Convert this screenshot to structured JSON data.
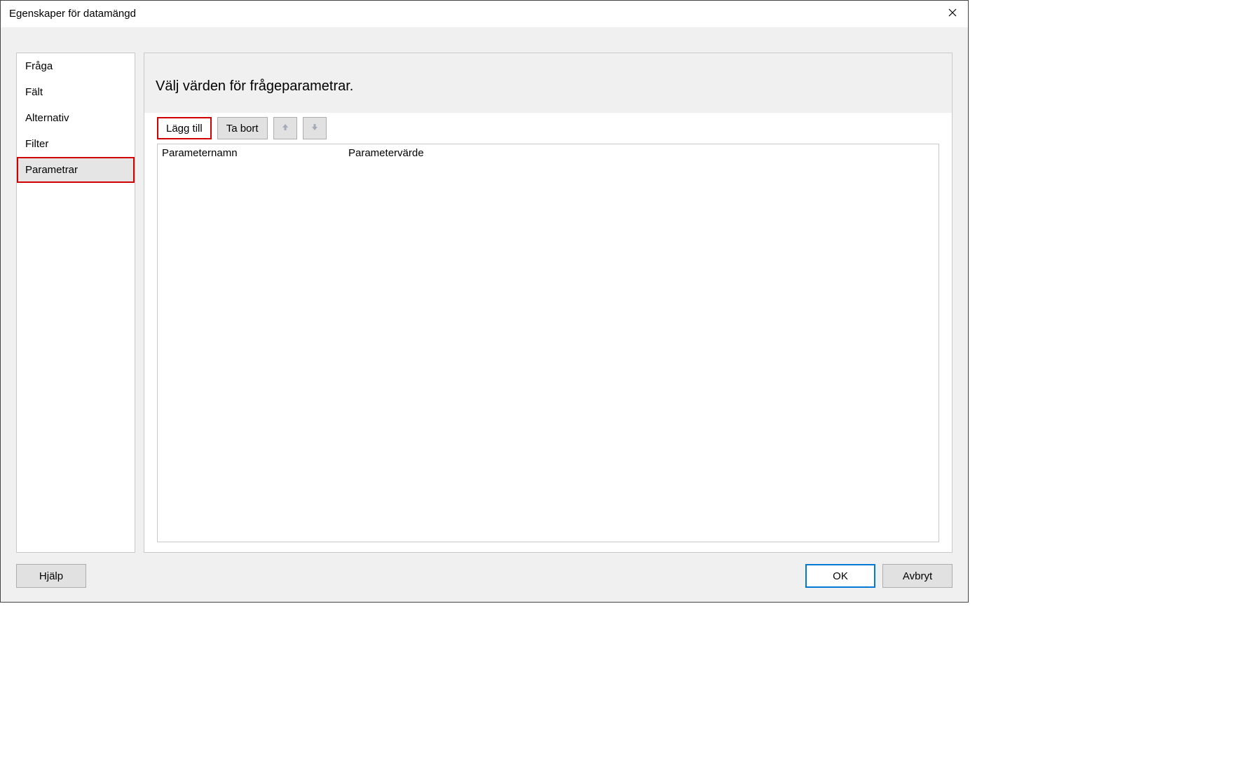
{
  "window": {
    "title": "Egenskaper för datamängd"
  },
  "sidebar": {
    "items": [
      {
        "label": "Fråga",
        "selected": false
      },
      {
        "label": "Fält",
        "selected": false
      },
      {
        "label": "Alternativ",
        "selected": false
      },
      {
        "label": "Filter",
        "selected": false
      },
      {
        "label": "Parametrar",
        "selected": true
      }
    ]
  },
  "content": {
    "heading": "Välj värden för frågeparametrar.",
    "toolbar": {
      "add_label": "Lägg till",
      "remove_label": "Ta bort"
    },
    "grid": {
      "columns": [
        "Parameternamn",
        "Parametervärde"
      ],
      "rows": []
    }
  },
  "footer": {
    "help_label": "Hjälp",
    "ok_label": "OK",
    "cancel_label": "Avbryt"
  }
}
